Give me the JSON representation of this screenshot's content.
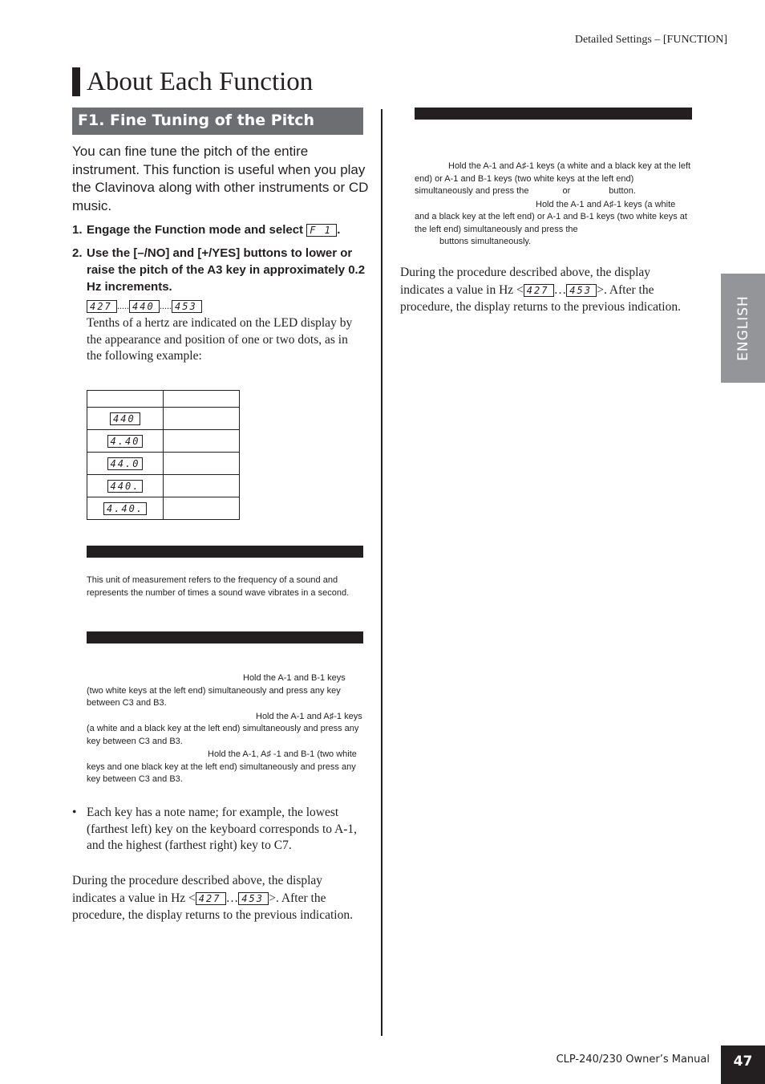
{
  "header": {
    "running_title": "Detailed Settings – [FUNCTION]"
  },
  "page_title": "About Each Function",
  "section": {
    "heading": "F1. Fine Tuning of the Pitch",
    "intro": "You can fine tune the pitch of the entire instrument. This function is useful when you play the Clavinova along with other instruments or CD music.",
    "steps": [
      {
        "num": "1.",
        "text": "Engage the Function mode and select",
        "led": "F 1",
        "suffix": "."
      },
      {
        "num": "2.",
        "text": "Use the [–/NO] and [+/YES] buttons to lower or raise the pitch of the A3 key in approximately 0.2 Hz increments."
      }
    ],
    "led_range": {
      "min": "427",
      "mid": "440",
      "max": "453",
      "separator": "....."
    },
    "tenths_text": "Tenths of a hertz are indicated on the LED display by the appearance and position of one or two dots, as in the following example:",
    "example_table": {
      "rows": [
        {
          "led": "440",
          "value": ""
        },
        {
          "led": "4.40",
          "value": ""
        },
        {
          "led": "44.0",
          "value": ""
        },
        {
          "led": "440.",
          "value": ""
        },
        {
          "led": "4.40.",
          "value": ""
        }
      ]
    },
    "hz_note": "This unit of measurement refers to the frequency of a sound and represents the number of times a sound wave vibrates in a second.",
    "keys_note": [
      "Hold the A-1 and B-1 keys (two white keys at the left end) simultaneously and press any key between C3 and B3.",
      "Hold the A-1 and A♯-1 keys (a white and a black key at the left end) simultaneously and press any key between C3 and B3.",
      "Hold the A-1, A♯ -1 and B-1 (two white keys and one black key at the left end) simultaneously and press any key between C3 and B3."
    ],
    "bullet": "Each key has a note name; for example, the lowest (farthest left) key on the keyboard corresponds to A-1, and the highest (farthest right) key to C7.",
    "during": {
      "before": "During the procedure described above, the display indicates a value in Hz <",
      "led_min": "427",
      "ellipsis": "…",
      "led_max": "453",
      "after": ">. After the procedure, the display returns to the previous indication."
    }
  },
  "right_column": {
    "note": [
      "Hold the A-1 and A♯-1 keys (a white and a black key at the left end) or A-1 and B-1 keys (two white keys at the left end) simultaneously and press the",
      "or",
      "button.",
      "Hold the A-1 and A♯-1 keys (a white and a black key at the left end) or A-1 and B-1 keys (two white keys at the left end) simultaneously and press the",
      "buttons simultaneously."
    ],
    "during": {
      "before": "During the procedure described above, the display indicates a value in Hz <",
      "led_min": "427",
      "ellipsis": "…",
      "led_max": "453",
      "after": ">. After the procedure, the display returns to the previous indication."
    }
  },
  "side_tab": {
    "label": "ENGLISH"
  },
  "footer": {
    "manual_name": "CLP-240/230 Owner’s Manual",
    "page_number": "47"
  }
}
